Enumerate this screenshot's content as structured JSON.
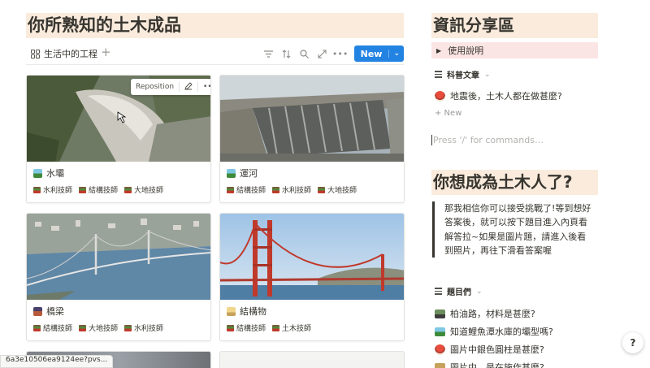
{
  "left": {
    "heading": "你所熟知的土木成品",
    "view_tab": "生活中的工程",
    "add_view": "+",
    "new_button": "New",
    "reposition": "Reposition",
    "cards": [
      {
        "title": "水壩",
        "tags": [
          "水利技師",
          "結構技師",
          "大地技師"
        ]
      },
      {
        "title": "運河",
        "tags": [
          "結構技師",
          "水利技師",
          "大地技師"
        ]
      },
      {
        "title": "橋梁",
        "tags": [
          "結構技師",
          "大地技師",
          "水利技師"
        ]
      },
      {
        "title": "結構物",
        "tags": [
          "結構技師",
          "土木技師"
        ]
      }
    ]
  },
  "right": {
    "heading1": "資訊分享區",
    "toggle": "使用說明",
    "db1_title": "科普文章",
    "db1_items": [
      "地震後，土木人都在做甚麼?"
    ],
    "new_label": "+ New",
    "placeholder": "Press '/' for commands…",
    "heading2": "你想成為土木人了?",
    "quote": "那我相信你可以接受挑戰了!等到想好答案後，就可以按下題目進入內頁看解答拉~如果是圖片題，請進入後看到照片，再往下滑看答案喔",
    "db2_title": "題目們",
    "db2_items": [
      "柏油路，材料是甚麼?",
      "知道鯉魚潭水庫的壩型嗎?",
      "圖片中銀色圓柱是甚麼?",
      "圖片中，是在施作甚麼?"
    ]
  },
  "status_url": "6a3e10506ea9124ee?pvs...",
  "help": "?",
  "icons": [
    "board-view-icon",
    "filter-icon",
    "sort-icon",
    "search-icon",
    "expand-icon",
    "more-icon",
    "edit-icon",
    "list-icon",
    "toggle-triangle-icon",
    "help-icon"
  ]
}
